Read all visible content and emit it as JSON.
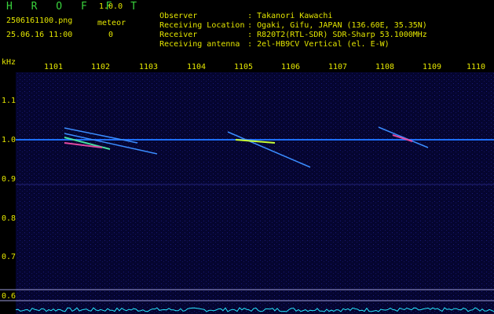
{
  "app": {
    "name": "H R O F F T",
    "version": "1.0.0"
  },
  "file": {
    "name": "2506161100.png",
    "datetime": "25.06.16 11:00"
  },
  "meteor": {
    "label": "meteor",
    "count": "0"
  },
  "info": [
    {
      "key": "Observer",
      "value": "Takanori Kawachi"
    },
    {
      "key": "Receiving Location",
      "value": "Ogaki, Gifu, JAPAN (136.60E, 35.35N)"
    },
    {
      "key": "Receiver",
      "value": "R820T2(RTL-SDR) SDR-Sharp 53.1000MHz"
    },
    {
      "key": "Receiving antenna",
      "value": "2el-HB9CV Vertical (el. E-W)"
    }
  ],
  "y_unit": "kHz",
  "x_ticks": [
    "1101",
    "1102",
    "1103",
    "1104",
    "1105",
    "1106",
    "1107",
    "1108",
    "1109",
    "1110"
  ],
  "y_ticks": [
    "1.1",
    "1.0",
    "0.9",
    "0.8",
    "0.7",
    "0.6"
  ],
  "colors": {
    "label": "#e4e600",
    "title": "#39d23c",
    "background": "#050530",
    "carrier": "#1e6fff"
  }
}
